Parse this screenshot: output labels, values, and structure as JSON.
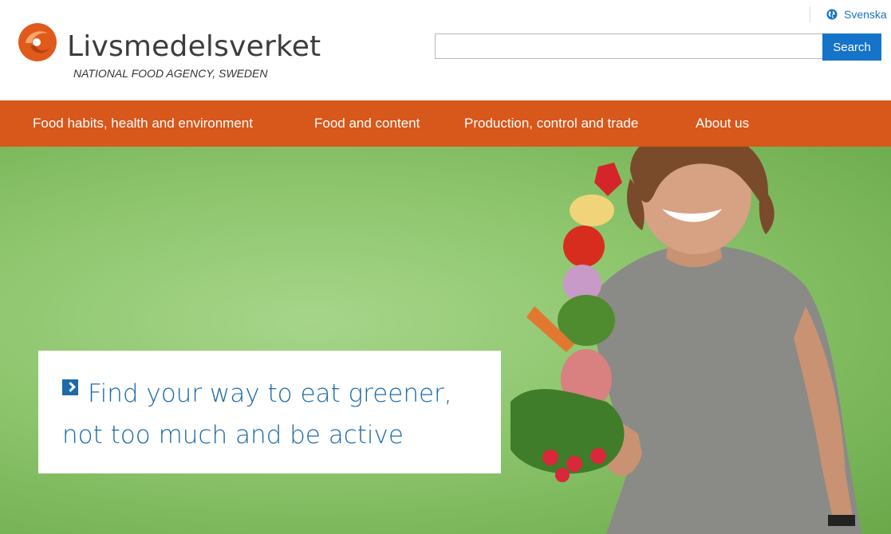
{
  "brand": {
    "name": "Livsmedelsverket",
    "subtitle": "NATIONAL FOOD AGENCY, SWEDEN",
    "accent_color": "#d8571a"
  },
  "language": {
    "icon": "globe-icon",
    "label": "Svenska"
  },
  "search": {
    "value": "",
    "placeholder": "",
    "button_label": "Search"
  },
  "nav": {
    "items": [
      {
        "label": "Food habits, health and environment"
      },
      {
        "label": "Food and content"
      },
      {
        "label": "Production, control and trade"
      },
      {
        "label": "About us"
      }
    ]
  },
  "hero": {
    "promo_text": "Find your way to eat greener, not too much and be active",
    "promo_icon": "chevron-right-icon"
  }
}
